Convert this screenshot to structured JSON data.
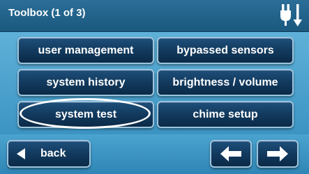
{
  "header": {
    "title": "Toolbox (1 of 3)",
    "status_icon": "power-plug-icon"
  },
  "menu": {
    "user_management": "user management",
    "bypassed_sensors": "bypassed sensors",
    "system_history": "system history",
    "brightness_volume": "brightness / volume",
    "system_test": "system test",
    "chime_setup": "chime setup"
  },
  "footer": {
    "back_label": "back",
    "back_icon": "triangle-left-icon",
    "prev_icon": "arrow-left-icon",
    "next_icon": "arrow-right-icon"
  },
  "colors": {
    "titlebar": "#1f6189",
    "button": "#123a5e",
    "panel": "#4ea3cf",
    "highlight": "#ffffff"
  }
}
